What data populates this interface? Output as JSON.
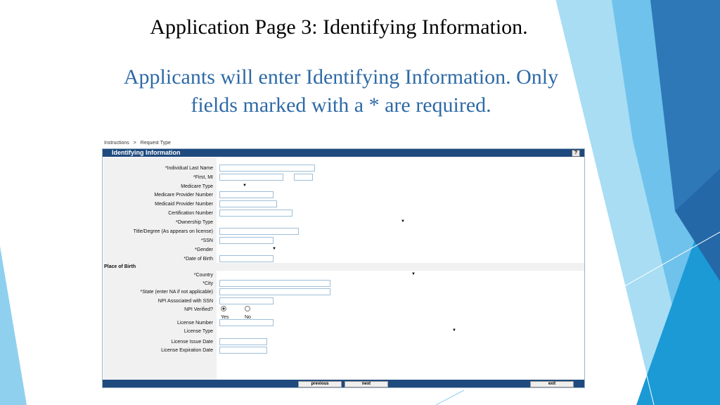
{
  "slide": {
    "title": "Application Page 3: Identifying Information.",
    "subtitle_line1": "Applicants will enter Identifying Information.  Only",
    "subtitle_line2": "fields marked with  a * are required.",
    "colors": {
      "subtitle": "#2e6aa6",
      "panel_header": "#1e4a7e",
      "deco_light": "#8fd0ef",
      "deco_dark": "#2a6db0"
    }
  },
  "breadcrumb": {
    "item1": "Instructions",
    "separator": ">",
    "item2": "Request Type"
  },
  "form": {
    "header": "Identifying Information",
    "help_label": "?",
    "fields": {
      "last_name": "*Individual Last Name",
      "first_mi": "*First, MI",
      "medicare_type": "Medicare Type",
      "medicare_provider": "Medicare Provider Number",
      "medicaid_provider": "Medicaid Provider Number",
      "certification": "Certification Number",
      "ownership_type": "*Ownership Type",
      "title_degree": "Title/Degree (As appears on license)",
      "ssn": "*SSN",
      "gender": "*Gender",
      "dob": "*Date of Birth",
      "place_of_birth": "Place of Birth",
      "country": "*Country",
      "city": "*City",
      "state": "*State (enter NA if not applicable)",
      "npi_ssn": "NPI Associated with SSN",
      "npi_verified": "NPI Verified?",
      "license_number": "License Number",
      "license_type": "License Type",
      "license_issue": "License Issue Date",
      "license_expiration": "License Expiration Date"
    },
    "npi_options": {
      "yes": "Yes",
      "no": "No",
      "selected": "Yes"
    },
    "select_arrow": "▼"
  },
  "buttons": {
    "previous": "previous",
    "next": "next",
    "exit": "exit"
  }
}
